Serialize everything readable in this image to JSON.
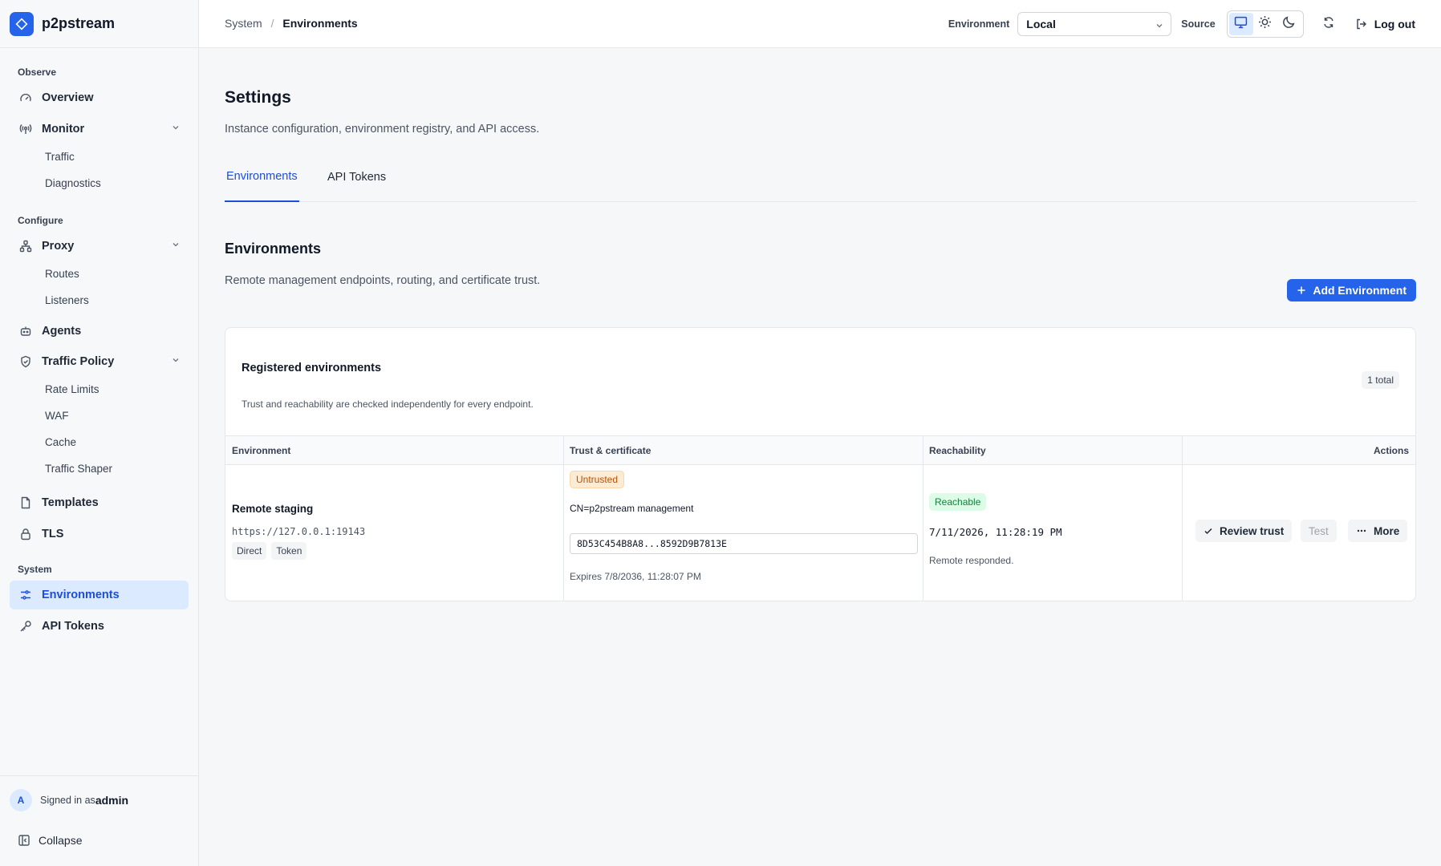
{
  "brand": {
    "name": "p2pstream"
  },
  "sidebar": {
    "sections": {
      "observe": "Observe",
      "configure": "Configure",
      "system": "System"
    },
    "items": {
      "overview": "Overview",
      "monitor": "Monitor",
      "traffic": "Traffic",
      "diagnostics": "Diagnostics",
      "proxy": "Proxy",
      "routes": "Routes",
      "listeners": "Listeners",
      "agents": "Agents",
      "traffic_policy": "Traffic Policy",
      "rate_limits": "Rate Limits",
      "waf": "WAF",
      "cache": "Cache",
      "traffic_shaper": "Traffic Shaper",
      "templates": "Templates",
      "tls": "TLS",
      "environments": "Environments",
      "api_tokens": "API Tokens"
    },
    "footer": {
      "avatar": "A",
      "signed_in_prefix": "Signed in as",
      "username": "admin",
      "collapse": "Collapse"
    }
  },
  "topbar": {
    "breadcrumb": {
      "parent": "System",
      "separator": "/",
      "current": "Environments"
    },
    "environment_label": "Environment",
    "environment_value": "Local",
    "source_label": "Source",
    "logout": "Log out"
  },
  "page": {
    "title": "Settings",
    "subtitle": "Instance configuration, environment registry, and API access.",
    "tabs": [
      "Environments",
      "API Tokens"
    ],
    "section_title": "Environments",
    "section_subtitle": "Remote management endpoints, routing, and certificate trust.",
    "add_button": "Add Environment"
  },
  "card": {
    "title": "Registered environments",
    "subtitle": "Trust and reachability are checked independently for every endpoint.",
    "total_badge": "1 total",
    "columns": [
      "Environment",
      "Trust & certificate",
      "Reachability",
      "Actions"
    ],
    "rows": [
      {
        "name": "Remote staging",
        "url": "https://127.0.0.1:19143",
        "tags": [
          "Direct",
          "Token"
        ],
        "trust_status": "Untrusted",
        "cert_cn": "CN=p2pstream management",
        "fingerprint": "8D53C454B8A8...8592D9B7813E",
        "expires": "Expires 7/8/2036, 11:28:07 PM",
        "reach_status": "Reachable",
        "reach_time": "7/11/2026, 11:28:19 PM",
        "reach_note": "Remote responded.",
        "actions": {
          "review": "Review trust",
          "test": "Test",
          "more": "More"
        }
      }
    ]
  },
  "colors": {
    "accent": "#2563eb",
    "active_nav_bg": "#dbeafe",
    "warn_bg": "#fdebd3",
    "warn_text": "#b45309",
    "ok_bg": "#dcfce7",
    "ok_text": "#15803d"
  },
  "icons": {
    "overview": "gauge-icon",
    "monitor": "radio-tower-icon",
    "proxy": "network-icon",
    "agents": "bot-icon",
    "traffic_policy": "shield-icon",
    "templates": "file-icon",
    "tls": "lock-icon",
    "environments": "sliders-icon",
    "api_tokens": "key-icon"
  }
}
